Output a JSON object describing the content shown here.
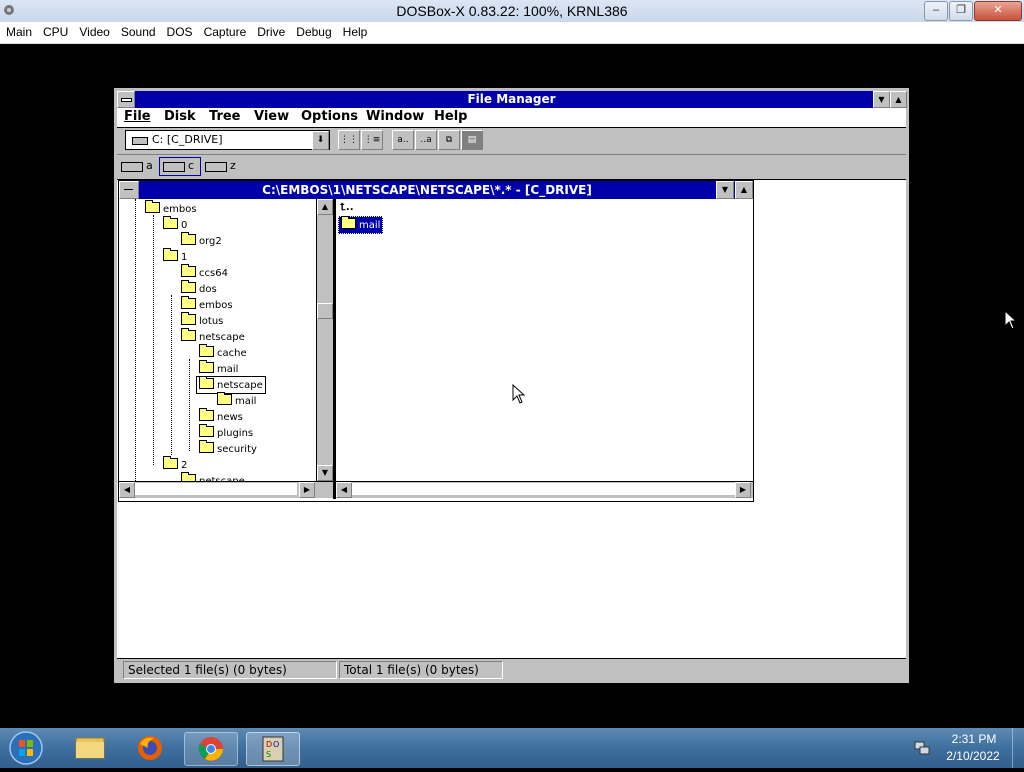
{
  "host": {
    "title": "DOSBox-X 0.83.22: 100%, KRNL386",
    "menu": [
      "Main",
      "CPU",
      "Video",
      "Sound",
      "DOS",
      "Capture",
      "Drive",
      "Debug",
      "Help"
    ],
    "controls": {
      "minimize": "–",
      "restore": "❐",
      "close": "✕"
    }
  },
  "file_manager": {
    "title": "File Manager",
    "menu": [
      "File",
      "Disk",
      "Tree",
      "View",
      "Options",
      "Window",
      "Help"
    ],
    "drive_select": "C: [C_DRIVE]",
    "toolbar_icons": [
      "connect-network-icon",
      "disconnect-network-icon",
      "view-name-icon",
      "view-details-icon",
      "sort-name-icon",
      "sort-type-icon",
      "copy-icon",
      "move-icon"
    ],
    "drives": [
      {
        "letter": "a",
        "selected": false
      },
      {
        "letter": "c",
        "selected": true
      },
      {
        "letter": "z",
        "selected": false
      }
    ],
    "child_title": "C:\\EMBOS\\1\\NETSCAPE\\NETSCAPE\\*.* - [C_DRIVE]",
    "tree": [
      {
        "label": "embos",
        "level": 0
      },
      {
        "label": "0",
        "level": 1
      },
      {
        "label": "org2",
        "level": 2
      },
      {
        "label": "1",
        "level": 1
      },
      {
        "label": "ccs64",
        "level": 2
      },
      {
        "label": "dos",
        "level": 2
      },
      {
        "label": "embos",
        "level": 2
      },
      {
        "label": "lotus",
        "level": 2
      },
      {
        "label": "netscape",
        "level": 2
      },
      {
        "label": "cache",
        "level": 3
      },
      {
        "label": "mail",
        "level": 3
      },
      {
        "label": "netscape",
        "level": 3,
        "selected": true,
        "open": true
      },
      {
        "label": "mail",
        "level": 4
      },
      {
        "label": "news",
        "level": 3
      },
      {
        "label": "plugins",
        "level": 3
      },
      {
        "label": "security",
        "level": 3
      },
      {
        "label": "2",
        "level": 1
      },
      {
        "label": "netscape",
        "level": 2
      }
    ],
    "files": [
      {
        "label": "..",
        "type": "parent"
      },
      {
        "label": "mail",
        "type": "folder",
        "selected": true
      }
    ],
    "status": {
      "selected": "Selected 1 file(s) (0 bytes)",
      "total": "Total 1 file(s) (0 bytes)"
    },
    "colors": {
      "titlebar": "#0000a8",
      "selection": "#0000a8",
      "face": "#c0c0c0"
    }
  },
  "taskbar": {
    "apps": [
      "windows-explorer-icon",
      "firefox-icon",
      "chrome-icon",
      "dosbox-icon"
    ],
    "clock": {
      "time": "2:31 PM",
      "date": "2/10/2022"
    }
  }
}
